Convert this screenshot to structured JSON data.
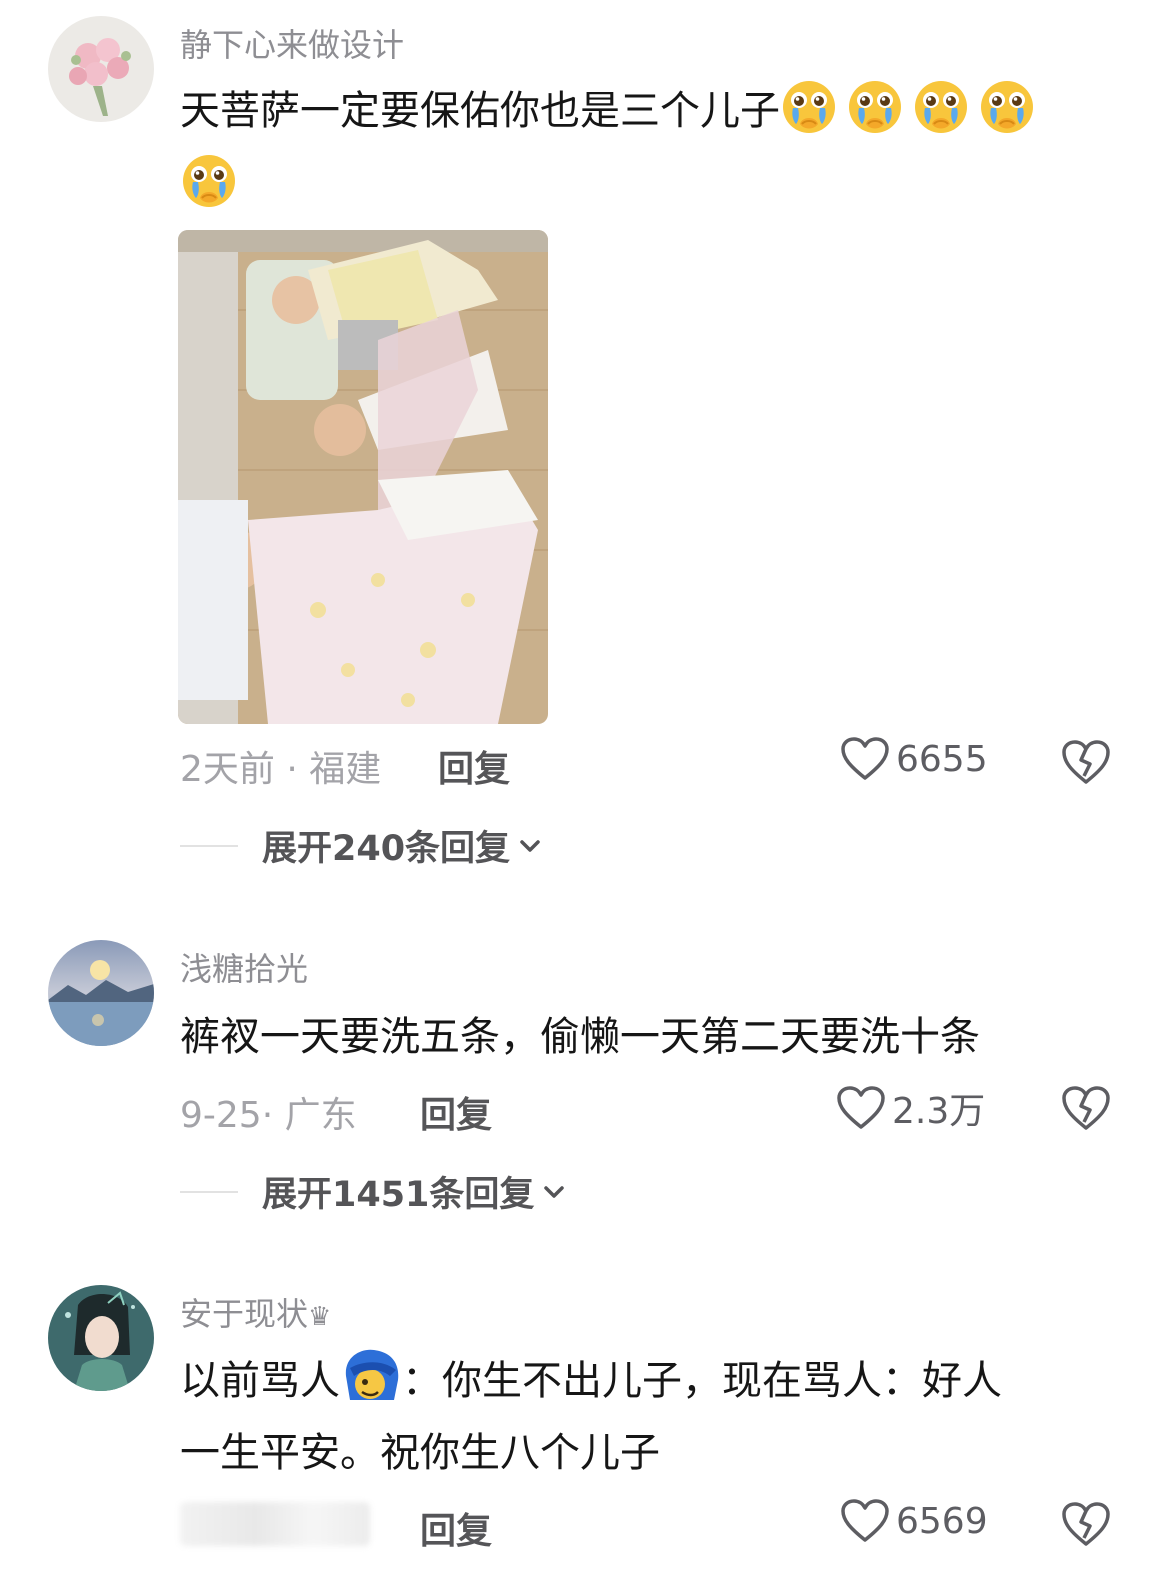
{
  "comments": [
    {
      "username": "静下心来做设计",
      "text_line1": "天菩萨一定要保佑你也是三个儿子",
      "emoji_name": "crying-face-emoji",
      "time_location": "2天前 · 福建",
      "reply_label": "回复",
      "likes": "6655",
      "expand_label": "展开240条回复"
    },
    {
      "username": "浅糖拾光",
      "text_line1": "裤衩一天要洗五条，偷懒一天第二天要洗十条",
      "time_location": "9-25· 广东",
      "reply_label": "回复",
      "likes": "2.3万",
      "expand_label": "展开1451条回复"
    },
    {
      "username": "安于现状",
      "crown": "♛",
      "text_line1_a": "以前骂人",
      "text_line1_b": "：你生不出儿子，现在骂人：好人",
      "text_line2": "一生平安。祝你生八个儿子",
      "reply_label": "回复",
      "likes": "6569"
    }
  ],
  "icons": [
    "heart-outline-icon",
    "broken-heart-icon",
    "chevron-down-icon"
  ],
  "colors": {
    "meta_gray": "#a3a3a8",
    "name_gray": "#8e8e93",
    "text": "#161616"
  }
}
